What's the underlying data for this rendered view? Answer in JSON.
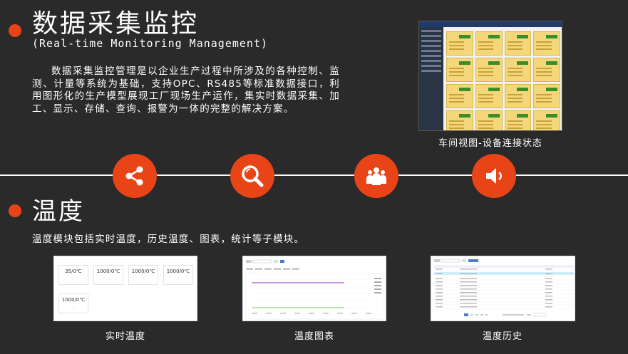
{
  "section1": {
    "title": "数据采集监控",
    "subtitle": "(Real-time Monitoring Management)",
    "paragraph": "数据采集监控管理是以企业生产过程中所涉及的各种控制、监测、计量等系统为基础，支持OPC、RS485等标准数据接口，利用图形化的生产模型展现工厂现场生产运作，集实时数据采集、加工、显示、存储、查询、报警为一体的完整的解决方案。",
    "screenshot_caption": "车间视图-设备连接状态"
  },
  "icons": [
    "share-icon",
    "search-icon",
    "group-icon",
    "speaker-icon"
  ],
  "section2": {
    "title": "温度",
    "description": "温度模块包括实时温度，历史温度、图表，统计等子模块。",
    "panels": [
      {
        "caption": "实时温度",
        "readings": [
          {
            "value": "35/0℃"
          },
          {
            "value": "1000/0℃"
          },
          {
            "value": "1000/0℃"
          },
          {
            "value": "1000/0℃"
          },
          {
            "value": "1000/0℃"
          }
        ]
      },
      {
        "caption": "温度图表"
      },
      {
        "caption": "温度历史"
      }
    ]
  },
  "colors": {
    "accent": "#e84417",
    "background": "#2a2a2a"
  }
}
